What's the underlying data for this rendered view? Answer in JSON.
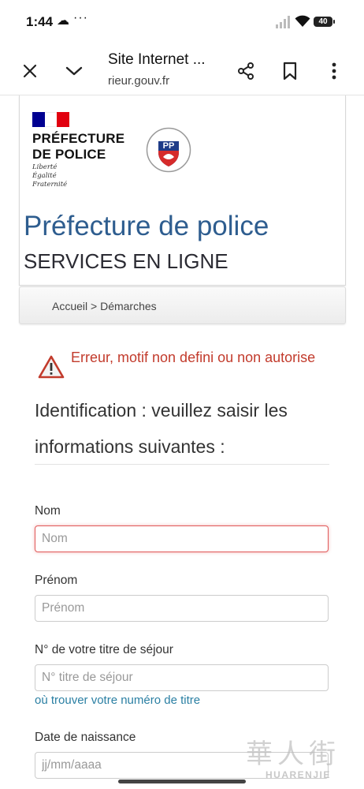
{
  "status_bar": {
    "time": "1:44",
    "cloud_icon": "☁",
    "more_dots": "···",
    "battery": "40"
  },
  "toolbar": {
    "title": "Site Internet ...",
    "url": "rieur.gouv.fr"
  },
  "header": {
    "logo_title": "PRÉFECTURE\nDE POLICE",
    "motto": "Liberté\nÉgalité\nFraternité",
    "site_name": "Préfecture de police",
    "site_subtitle": "SERVICES EN LIGNE",
    "seal_letters": "PP"
  },
  "breadcrumb": "Accueil > Démarches",
  "error": {
    "message": "Erreur, motif non defini ou non autorise"
  },
  "form": {
    "heading": "Identification : veuillez saisir les informations suivantes :",
    "fields": [
      {
        "label": "Nom",
        "placeholder": "Nom"
      },
      {
        "label": "Prénom",
        "placeholder": "Prénom"
      },
      {
        "label": "N° de votre titre de séjour",
        "placeholder": "N° titre de séjour"
      },
      {
        "label": "Date de naissance",
        "placeholder": "jj/mm/aaaa"
      }
    ],
    "help_link": "où trouver votre numéro de titre"
  },
  "watermark": {
    "text": "華人街",
    "sub": "HUARENJIE"
  },
  "colors": {
    "site_name": "#2e5d8f",
    "error": "#c23b2c",
    "link": "#2a7fa3",
    "flag_blue": "#000091",
    "flag_red": "#e1000f"
  }
}
